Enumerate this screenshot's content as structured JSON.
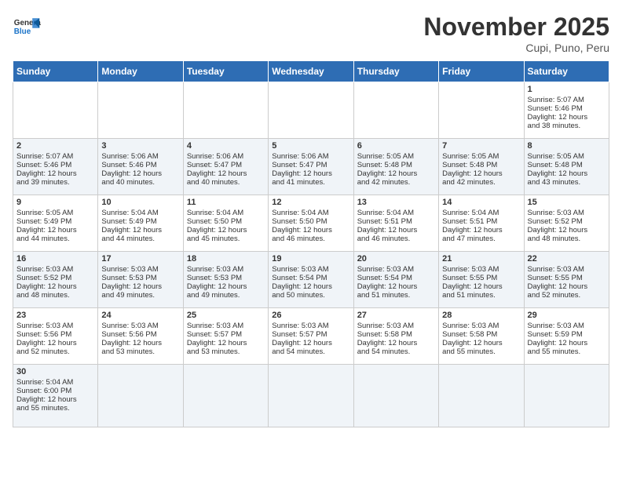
{
  "header": {
    "logo_general": "General",
    "logo_blue": "Blue",
    "month": "November 2025",
    "location": "Cupi, Puno, Peru"
  },
  "days_of_week": [
    "Sunday",
    "Monday",
    "Tuesday",
    "Wednesday",
    "Thursday",
    "Friday",
    "Saturday"
  ],
  "weeks": [
    [
      {
        "day": "",
        "data": ""
      },
      {
        "day": "",
        "data": ""
      },
      {
        "day": "",
        "data": ""
      },
      {
        "day": "",
        "data": ""
      },
      {
        "day": "",
        "data": ""
      },
      {
        "day": "",
        "data": ""
      },
      {
        "day": "1",
        "data": "Sunrise: 5:07 AM\nSunset: 5:46 PM\nDaylight: 12 hours\nand 38 minutes."
      }
    ],
    [
      {
        "day": "2",
        "data": "Sunrise: 5:07 AM\nSunset: 5:46 PM\nDaylight: 12 hours\nand 39 minutes."
      },
      {
        "day": "3",
        "data": "Sunrise: 5:06 AM\nSunset: 5:46 PM\nDaylight: 12 hours\nand 40 minutes."
      },
      {
        "day": "4",
        "data": "Sunrise: 5:06 AM\nSunset: 5:47 PM\nDaylight: 12 hours\nand 40 minutes."
      },
      {
        "day": "5",
        "data": "Sunrise: 5:06 AM\nSunset: 5:47 PM\nDaylight: 12 hours\nand 41 minutes."
      },
      {
        "day": "6",
        "data": "Sunrise: 5:05 AM\nSunset: 5:48 PM\nDaylight: 12 hours\nand 42 minutes."
      },
      {
        "day": "7",
        "data": "Sunrise: 5:05 AM\nSunset: 5:48 PM\nDaylight: 12 hours\nand 42 minutes."
      },
      {
        "day": "8",
        "data": "Sunrise: 5:05 AM\nSunset: 5:48 PM\nDaylight: 12 hours\nand 43 minutes."
      }
    ],
    [
      {
        "day": "9",
        "data": "Sunrise: 5:05 AM\nSunset: 5:49 PM\nDaylight: 12 hours\nand 44 minutes."
      },
      {
        "day": "10",
        "data": "Sunrise: 5:04 AM\nSunset: 5:49 PM\nDaylight: 12 hours\nand 44 minutes."
      },
      {
        "day": "11",
        "data": "Sunrise: 5:04 AM\nSunset: 5:50 PM\nDaylight: 12 hours\nand 45 minutes."
      },
      {
        "day": "12",
        "data": "Sunrise: 5:04 AM\nSunset: 5:50 PM\nDaylight: 12 hours\nand 46 minutes."
      },
      {
        "day": "13",
        "data": "Sunrise: 5:04 AM\nSunset: 5:51 PM\nDaylight: 12 hours\nand 46 minutes."
      },
      {
        "day": "14",
        "data": "Sunrise: 5:04 AM\nSunset: 5:51 PM\nDaylight: 12 hours\nand 47 minutes."
      },
      {
        "day": "15",
        "data": "Sunrise: 5:03 AM\nSunset: 5:52 PM\nDaylight: 12 hours\nand 48 minutes."
      }
    ],
    [
      {
        "day": "16",
        "data": "Sunrise: 5:03 AM\nSunset: 5:52 PM\nDaylight: 12 hours\nand 48 minutes."
      },
      {
        "day": "17",
        "data": "Sunrise: 5:03 AM\nSunset: 5:53 PM\nDaylight: 12 hours\nand 49 minutes."
      },
      {
        "day": "18",
        "data": "Sunrise: 5:03 AM\nSunset: 5:53 PM\nDaylight: 12 hours\nand 49 minutes."
      },
      {
        "day": "19",
        "data": "Sunrise: 5:03 AM\nSunset: 5:54 PM\nDaylight: 12 hours\nand 50 minutes."
      },
      {
        "day": "20",
        "data": "Sunrise: 5:03 AM\nSunset: 5:54 PM\nDaylight: 12 hours\nand 51 minutes."
      },
      {
        "day": "21",
        "data": "Sunrise: 5:03 AM\nSunset: 5:55 PM\nDaylight: 12 hours\nand 51 minutes."
      },
      {
        "day": "22",
        "data": "Sunrise: 5:03 AM\nSunset: 5:55 PM\nDaylight: 12 hours\nand 52 minutes."
      }
    ],
    [
      {
        "day": "23",
        "data": "Sunrise: 5:03 AM\nSunset: 5:56 PM\nDaylight: 12 hours\nand 52 minutes."
      },
      {
        "day": "24",
        "data": "Sunrise: 5:03 AM\nSunset: 5:56 PM\nDaylight: 12 hours\nand 53 minutes."
      },
      {
        "day": "25",
        "data": "Sunrise: 5:03 AM\nSunset: 5:57 PM\nDaylight: 12 hours\nand 53 minutes."
      },
      {
        "day": "26",
        "data": "Sunrise: 5:03 AM\nSunset: 5:57 PM\nDaylight: 12 hours\nand 54 minutes."
      },
      {
        "day": "27",
        "data": "Sunrise: 5:03 AM\nSunset: 5:58 PM\nDaylight: 12 hours\nand 54 minutes."
      },
      {
        "day": "28",
        "data": "Sunrise: 5:03 AM\nSunset: 5:58 PM\nDaylight: 12 hours\nand 55 minutes."
      },
      {
        "day": "29",
        "data": "Sunrise: 5:03 AM\nSunset: 5:59 PM\nDaylight: 12 hours\nand 55 minutes."
      }
    ],
    [
      {
        "day": "30",
        "data": "Sunrise: 5:04 AM\nSunset: 6:00 PM\nDaylight: 12 hours\nand 55 minutes."
      },
      {
        "day": "",
        "data": ""
      },
      {
        "day": "",
        "data": ""
      },
      {
        "day": "",
        "data": ""
      },
      {
        "day": "",
        "data": ""
      },
      {
        "day": "",
        "data": ""
      },
      {
        "day": "",
        "data": ""
      }
    ]
  ]
}
